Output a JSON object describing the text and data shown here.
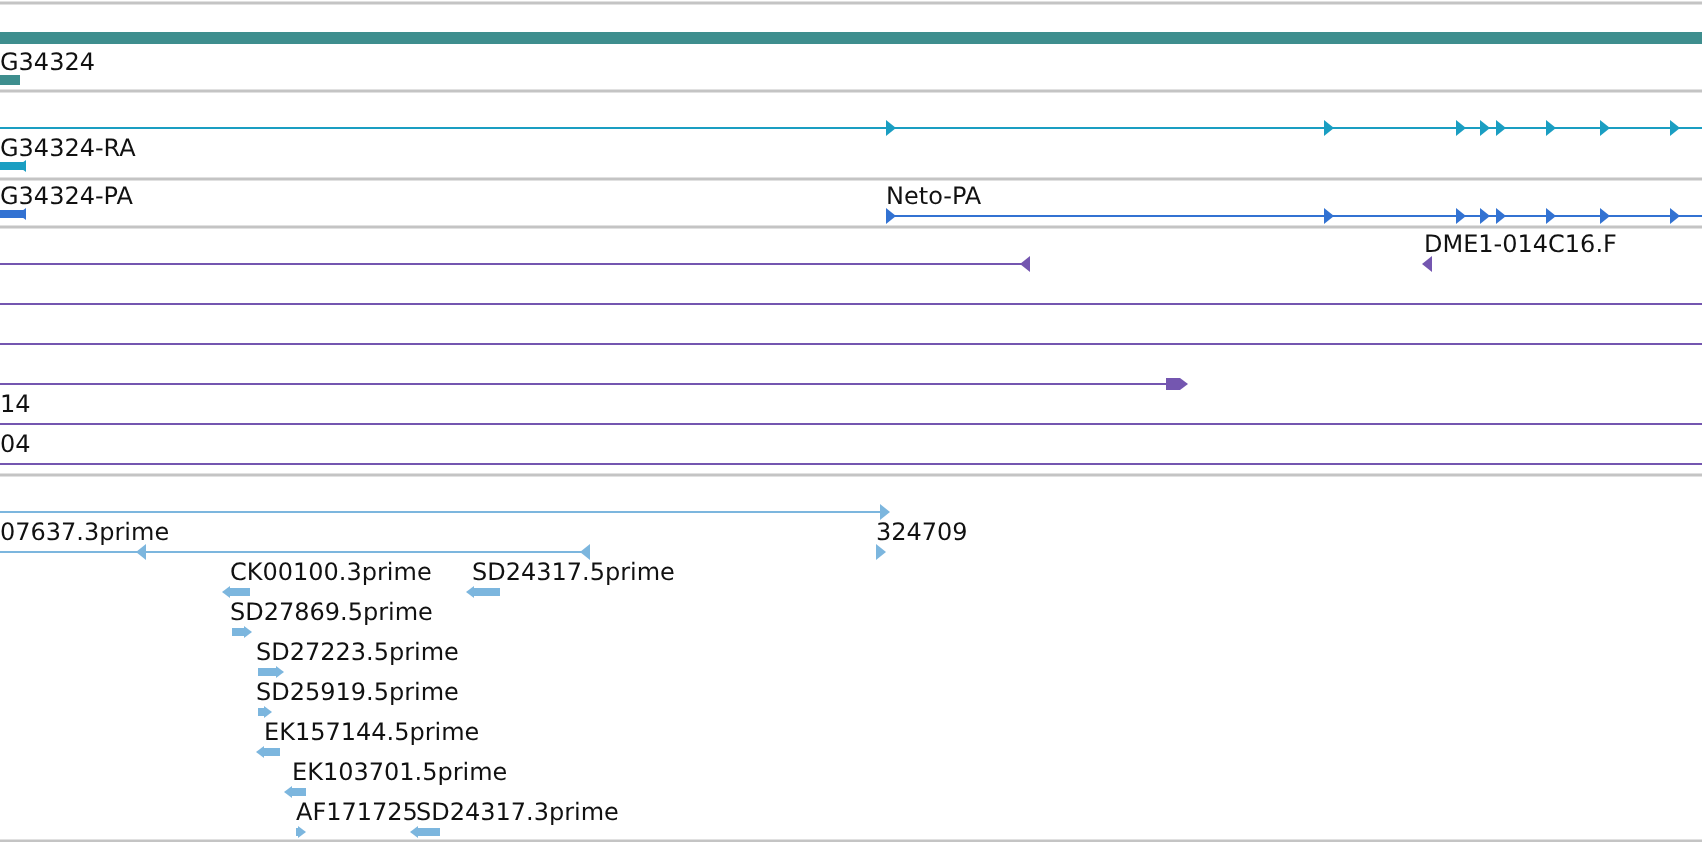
{
  "tracks": [
    {
      "color": "#3e8e8e",
      "features": [
        {
          "kind": "plain"
        },
        {
          "label": "G34324",
          "kind": "plain"
        }
      ]
    },
    {
      "color": "#1a9ec2",
      "features": [
        {
          "kind": "forward"
        },
        {
          "label": "G34324-RA",
          "kind": "reverse"
        }
      ]
    },
    {
      "color": "#3272d2",
      "features": [
        {
          "label": "G34324-PA",
          "kind": "reverse"
        },
        {
          "label": "Neto-PA",
          "kind": "forward"
        }
      ]
    },
    {
      "color": "#7456b0",
      "features": [
        {
          "kind": "reverse"
        },
        {
          "label": "DME1-014C16.F",
          "kind": "reverse"
        },
        {
          "kind": "plain"
        },
        {
          "kind": "plain"
        },
        {
          "kind": "forward"
        },
        {
          "label": "14",
          "kind": "plain"
        },
        {
          "label": "04",
          "kind": "plain"
        }
      ]
    },
    {
      "color": "#7cb6de",
      "features": [
        {
          "kind": "forward"
        },
        {
          "label": "07637.3prime",
          "kind": "reverse"
        },
        {
          "label": "324709",
          "kind": "forward"
        },
        {
          "label": "CK00100.3prime",
          "kind": "reverse"
        },
        {
          "label": "SD24317.5prime",
          "kind": "reverse"
        },
        {
          "label": "SD27869.5prime",
          "kind": "forward"
        },
        {
          "label": "SD27223.5prime",
          "kind": "forward"
        },
        {
          "label": "SD25919.5prime",
          "kind": "forward"
        },
        {
          "label": "EK157144.5prime",
          "kind": "reverse"
        },
        {
          "label": "EK103701.5prime",
          "kind": "reverse"
        },
        {
          "label": "AF171725",
          "kind": "forward"
        },
        {
          "label": "SD24317.3prime",
          "kind": "reverse"
        }
      ]
    }
  ]
}
